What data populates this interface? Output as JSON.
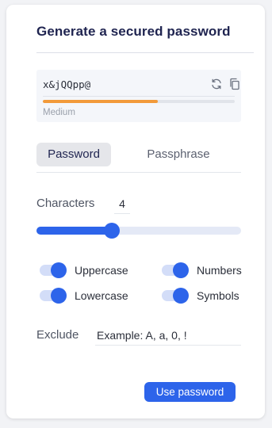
{
  "title": "Generate a secured password",
  "password": {
    "value": "x&jQQpp@",
    "strength_label": "Medium",
    "strength_fraction": 0.6,
    "strength_color": "#f29a3a"
  },
  "tabs": [
    {
      "label": "Password",
      "active": true
    },
    {
      "label": "Passphrase",
      "active": false
    }
  ],
  "characters": {
    "label": "Characters",
    "value": "4",
    "slider_fraction": 0.37
  },
  "options": [
    {
      "label": "Uppercase",
      "enabled": true
    },
    {
      "label": "Numbers",
      "enabled": true
    },
    {
      "label": "Lowercase",
      "enabled": true
    },
    {
      "label": "Symbols",
      "enabled": true
    }
  ],
  "exclude": {
    "label": "Exclude",
    "placeholder": "Example: A, a, 0, !",
    "value": ""
  },
  "use_button": {
    "label": "Use password"
  },
  "colors": {
    "accent": "#2d64ea",
    "title": "#1f2450"
  },
  "icons": {
    "regenerate": "refresh-icon",
    "copy": "copy-icon"
  }
}
